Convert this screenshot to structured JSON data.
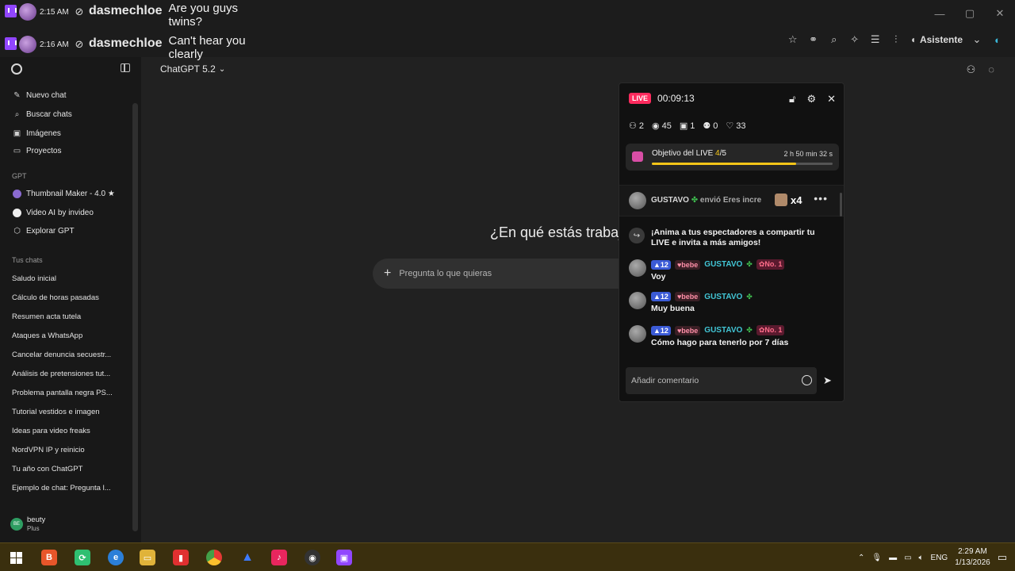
{
  "twitch": [
    {
      "time": "2:15 AM",
      "user": "dasmechloe",
      "text": "Are you guys twins?"
    },
    {
      "time": "2:16 AM",
      "user": "dasmechloe",
      "text": "Can't hear you clearly"
    }
  ],
  "browser": {
    "assistant_label": "Asistente"
  },
  "sidebar": {
    "nav": [
      {
        "label": "Nuevo chat",
        "icon": "edit-icon"
      },
      {
        "label": "Buscar chats",
        "icon": "search-icon"
      },
      {
        "label": "Imágenes",
        "icon": "image-icon"
      },
      {
        "label": "Proyectos",
        "icon": "folder-icon"
      }
    ],
    "gpt_section": "GPT",
    "gpts": [
      {
        "label": "Thumbnail Maker - 4.0 ★"
      },
      {
        "label": "Video AI by invideo"
      },
      {
        "label": "Explorar GPT"
      }
    ],
    "chats_section": "Tus chats",
    "chats": [
      "Saludo inicial",
      "Cálculo de horas pasadas",
      "Resumen acta tutela",
      "Ataques a WhatsApp",
      "Cancelar denuncia secuestr...",
      "Análisis de pretensiones tut...",
      "Problema pantalla negra PS...",
      "Tutorial vestidos e imagen",
      "Ideas para video freaks",
      "NordVPN IP y reinicio",
      "Tu año con ChatGPT",
      "Ejemplo de chat: Pregunta l..."
    ],
    "user": {
      "initials": "BE",
      "name": "beuty",
      "plan": "Plus"
    }
  },
  "main": {
    "model": "ChatGPT 5.2",
    "headline": "¿En qué estás trabajando?",
    "prompt_placeholder": "Pregunta lo que quieras"
  },
  "live": {
    "badge": "LIVE",
    "timer": "00:09:13",
    "stats": {
      "users": "2",
      "viewers": "45",
      "gifts": "1",
      "follows": "0",
      "likes": "33"
    },
    "goal": {
      "label_prefix": "Objetivo del LIVE ",
      "current": "4",
      "target": "/5",
      "time_left": "2 h 50 min 32 s",
      "progress": 0.8
    },
    "gift_event": {
      "user": "GUSTAVO",
      "sent": "envió Eres incre",
      "count": "x4"
    },
    "share_prompt": "¡Anima a tus espectadores a compartir tu LIVE e invita a más amigos!",
    "comments": [
      {
        "level": "12",
        "fan": "bebe",
        "user": "GUSTAVO",
        "rank": "No. 1",
        "text": "Voy"
      },
      {
        "level": "12",
        "fan": "bebe",
        "user": "GUSTAVO",
        "rank": "",
        "text": "Muy buena"
      },
      {
        "level": "12",
        "fan": "bebe",
        "user": "GUSTAVO",
        "rank": "No. 1",
        "text": "Cómo hago para tenerlo por 7 días"
      }
    ],
    "comment_placeholder": "Añadir comentario"
  },
  "taskbar": {
    "lang": "ENG",
    "time": "2:29 AM",
    "date": "1/13/2026"
  }
}
